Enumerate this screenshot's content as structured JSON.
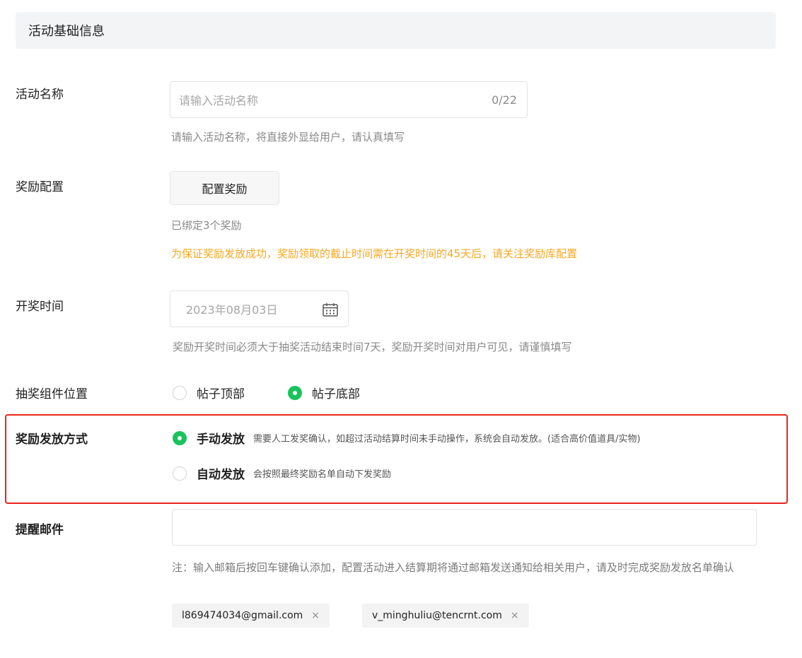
{
  "section": {
    "title": "活动基础信息"
  },
  "activity_name": {
    "label": "活动名称",
    "placeholder": "请输入活动名称",
    "counter": "0/22",
    "hint": "请输入活动名称，将直接外显给用户，请认真填写"
  },
  "reward_config": {
    "label": "奖励配置",
    "button": "配置奖励",
    "bound_text": "已绑定3个奖励",
    "warning": "为保证奖励发放成功，奖励领取的截止时间需在开奖时间的45天后，请关注奖励库配置"
  },
  "draw_time": {
    "label": "开奖时间",
    "value": "2023年08月03日",
    "icon": "calendar-icon",
    "hint": "奖励开奖时间必须大于抽奖活动结束时间7天，奖励开奖时间对用户可见，请谨慎填写"
  },
  "widget_position": {
    "label": "抽奖组件位置",
    "options": [
      {
        "label": "帖子顶部",
        "checked": false
      },
      {
        "label": "帖子底部",
        "checked": true
      }
    ]
  },
  "distribution": {
    "label": "奖励发放方式",
    "options": [
      {
        "label": "手动发放",
        "desc": "需要人工发奖确认，如超过活动结算时间未手动操作，系统会自动发放。(适合高价值道具/实物)",
        "checked": true
      },
      {
        "label": "自动发放",
        "desc": "会按照最终奖励名单自动下发奖励",
        "checked": false
      }
    ]
  },
  "reminder_email": {
    "label": "提醒邮件",
    "note": "注：输入邮箱后按回车键确认添加，配置活动进入结算期将通过邮箱发送通知给相关用户，请及时完成奖励发放名单确认",
    "tags": [
      {
        "email": "l869474034@gmail.com",
        "close": "×"
      },
      {
        "email": "v_minghuliu@tencrnt.com",
        "close": "×"
      }
    ]
  },
  "colors": {
    "accent": "#19c35b",
    "warning": "#f6a821",
    "highlight": "#e8251b"
  }
}
